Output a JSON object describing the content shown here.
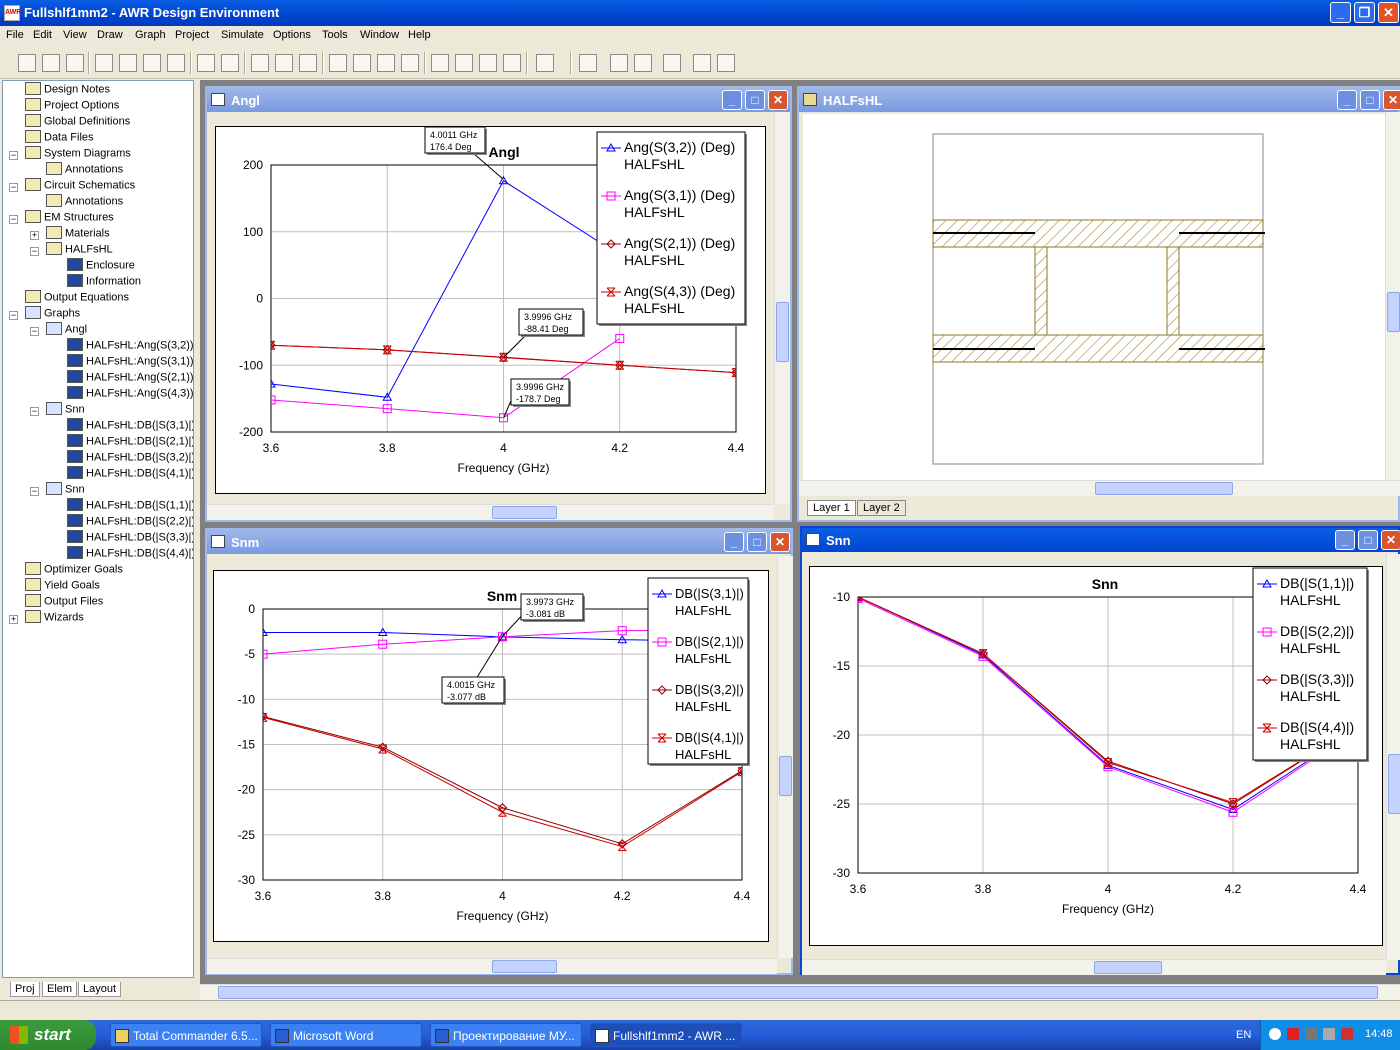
{
  "app": {
    "title": "Fullshlf1mm2 - AWR Design Environment",
    "icon_text": "AWR"
  },
  "menu": [
    "File",
    "Edit",
    "View",
    "Draw",
    "Graph",
    "Project",
    "Simulate",
    "Options",
    "Tools",
    "Window",
    "Help"
  ],
  "tree": {
    "items": [
      {
        "label": "Design Notes",
        "level": 1
      },
      {
        "label": "Project Options",
        "level": 1
      },
      {
        "label": "Global Definitions",
        "level": 1
      },
      {
        "label": "Data Files",
        "level": 1
      },
      {
        "label": "System Diagrams",
        "level": 1
      },
      {
        "label": "Annotations",
        "level": 2
      },
      {
        "label": "Circuit Schematics",
        "level": 1
      },
      {
        "label": "Annotations",
        "level": 2
      },
      {
        "label": "EM Structures",
        "level": 1
      },
      {
        "label": "Materials",
        "level": 2
      },
      {
        "label": "HALFsHL",
        "level": 2
      },
      {
        "label": "Enclosure",
        "level": 3
      },
      {
        "label": "Information",
        "level": 3
      },
      {
        "label": "Output Equations",
        "level": 1
      },
      {
        "label": "Graphs",
        "level": 1
      },
      {
        "label": "Angl",
        "level": 2
      },
      {
        "label": "HALFsHL:Ang(S(3,2))",
        "level": 3
      },
      {
        "label": "HALFsHL:Ang(S(3,1))",
        "level": 3
      },
      {
        "label": "HALFsHL:Ang(S(2,1))",
        "level": 3
      },
      {
        "label": "HALFsHL:Ang(S(4,3))",
        "level": 3
      },
      {
        "label": "Snn",
        "level": 2
      },
      {
        "label": "HALFsHL:DB(|S(3,1)|)",
        "level": 3
      },
      {
        "label": "HALFsHL:DB(|S(2,1)|)",
        "level": 3
      },
      {
        "label": "HALFsHL:DB(|S(3,2)|)",
        "level": 3
      },
      {
        "label": "HALFsHL:DB(|S(4,1)|)",
        "level": 3
      },
      {
        "label": "Snn",
        "level": 2
      },
      {
        "label": "HALFsHL:DB(|S(1,1)|)",
        "level": 3
      },
      {
        "label": "HALFsHL:DB(|S(2,2)|)",
        "level": 3
      },
      {
        "label": "HALFsHL:DB(|S(3,3)|)",
        "level": 3
      },
      {
        "label": "HALFsHL:DB(|S(4,4)|)",
        "level": 3
      },
      {
        "label": "Optimizer Goals",
        "level": 1
      },
      {
        "label": "Yield Goals",
        "level": 1
      },
      {
        "label": "Output Files",
        "level": 1
      },
      {
        "label": "Wizards",
        "level": 1
      }
    ],
    "tabs": [
      "Proj",
      "Elem",
      "Layout"
    ]
  },
  "windows": {
    "angl": {
      "title": "Angl"
    },
    "halfshl": {
      "title": "HALFsHL",
      "layer_tabs": [
        "Layer 1",
        "Layer 2"
      ]
    },
    "snm": {
      "title": "Snm"
    },
    "snn": {
      "title": "Snn"
    }
  },
  "chart_data": [
    {
      "type": "line",
      "title": "Angl",
      "xlabel": "Frequency (GHz)",
      "ylabel": "",
      "x": [
        3.6,
        3.8,
        4.0,
        4.2,
        4.4
      ],
      "xlim": [
        3.6,
        4.4
      ],
      "ylim": [
        -200,
        200
      ],
      "xticks": [
        "3.6",
        "3.8",
        "4",
        "4.2",
        "4.4"
      ],
      "yticks": [
        "200",
        "100",
        "0",
        "-100",
        "-200"
      ],
      "series": [
        {
          "name": "Ang(S(3,2)) (Deg)",
          "sub": "HALFsHL",
          "color": "#0000ff",
          "marker": "triangle",
          "values": [
            -128,
            -148,
            176.4,
            65,
            null
          ]
        },
        {
          "name": "Ang(S(3,1)) (Deg)",
          "sub": "HALFsHL",
          "color": "#ff00ff",
          "marker": "square",
          "values": [
            -152,
            -165,
            -178.7,
            -60,
            null
          ]
        },
        {
          "name": "Ang(S(2,1)) (Deg)",
          "sub": "HALFsHL",
          "color": "#8b0000",
          "marker": "diamond",
          "values": [
            -70,
            -77,
            -88.41,
            -100,
            -111
          ]
        },
        {
          "name": "Ang(S(4,3)) (Deg)",
          "sub": "HALFsHL",
          "color": "#cc0000",
          "marker": "x",
          "values": [
            -70,
            -77,
            -88,
            -100,
            -111
          ]
        }
      ],
      "markers": [
        {
          "lines": [
            "4.0011 GHz",
            "176.4 Deg"
          ]
        },
        {
          "lines": [
            "3.9996 GHz",
            "-88.41 Deg"
          ]
        },
        {
          "lines": [
            "3.9996 GHz",
            "-178.7 Deg"
          ]
        }
      ],
      "grid": true,
      "legend": "top-right"
    },
    {
      "type": "line",
      "title": "Snm",
      "xlabel": "Frequency (GHz)",
      "ylabel": "",
      "x": [
        3.6,
        3.8,
        4.0,
        4.2,
        4.4
      ],
      "xlim": [
        3.6,
        4.4
      ],
      "ylim": [
        -30,
        0
      ],
      "xticks": [
        "3.6",
        "3.8",
        "4",
        "4.2",
        "4.4"
      ],
      "yticks": [
        "0",
        "-5",
        "-10",
        "-15",
        "-20",
        "-25",
        "-30"
      ],
      "series": [
        {
          "name": "DB(|S(3,1)|)",
          "sub": "HALFsHL",
          "color": "#0000ff",
          "marker": "triangle",
          "values": [
            -2.6,
            -2.6,
            -3.081,
            -3.4,
            -3.6
          ]
        },
        {
          "name": "DB(|S(2,1)|)",
          "sub": "HALFsHL",
          "color": "#ff00ff",
          "marker": "square",
          "values": [
            -5.0,
            -3.9,
            -3.077,
            -2.4,
            -2.3
          ]
        },
        {
          "name": "DB(|S(3,2)|)",
          "sub": "HALFsHL",
          "color": "#8b0000",
          "marker": "diamond",
          "values": [
            -11.9,
            -15.3,
            -22.0,
            -26.0,
            -17.9
          ]
        },
        {
          "name": "DB(|S(4,1)|)",
          "sub": "HALFsHL",
          "color": "#cc0000",
          "marker": "x",
          "values": [
            -12.0,
            -15.5,
            -22.5,
            -26.3,
            -18.0
          ]
        }
      ],
      "markers": [
        {
          "lines": [
            "3.9973 GHz",
            "-3.081 dB"
          ]
        },
        {
          "lines": [
            "4.0015 GHz",
            "-3.077 dB"
          ]
        }
      ],
      "grid": true,
      "legend": "top-right"
    },
    {
      "type": "line",
      "title": "Snn",
      "xlabel": "Frequency (GHz)",
      "ylabel": "",
      "x": [
        3.6,
        3.8,
        4.0,
        4.2,
        4.4
      ],
      "xlim": [
        3.6,
        4.4
      ],
      "ylim": [
        -30,
        -10
      ],
      "xticks": [
        "3.6",
        "3.8",
        "4",
        "4.2",
        "4.4"
      ],
      "yticks": [
        "-10",
        "-15",
        "-20",
        "-25",
        "-30"
      ],
      "series": [
        {
          "name": "DB(|S(1,1)|)",
          "sub": "HALFsHL",
          "color": "#0000ff",
          "marker": "triangle",
          "values": [
            -10.0,
            -14.2,
            -22.2,
            -25.4,
            -19.5
          ]
        },
        {
          "name": "DB(|S(2,2)|)",
          "sub": "HALFsHL",
          "color": "#ff00ff",
          "marker": "square",
          "values": [
            -10.1,
            -14.3,
            -22.3,
            -25.6,
            -19.6
          ]
        },
        {
          "name": "DB(|S(3,3)|)",
          "sub": "HALFsHL",
          "color": "#8b0000",
          "marker": "diamond",
          "values": [
            -10.0,
            -14.1,
            -21.9,
            -25.0,
            -19.3
          ]
        },
        {
          "name": "DB(|S(4,4)|)",
          "sub": "HALFsHL",
          "color": "#cc0000",
          "marker": "x",
          "values": [
            -10.0,
            -14.1,
            -22.0,
            -24.9,
            -19.3
          ]
        }
      ],
      "markers": [],
      "grid": true,
      "legend": "top-right"
    }
  ],
  "taskbar": {
    "start": "start",
    "tasks": [
      "Total Commander 6.5...",
      "Microsoft Word",
      "Проектирование МУ...",
      "Fullshlf1mm2 - AWR ..."
    ],
    "lang": "EN",
    "clock": "14:48"
  }
}
